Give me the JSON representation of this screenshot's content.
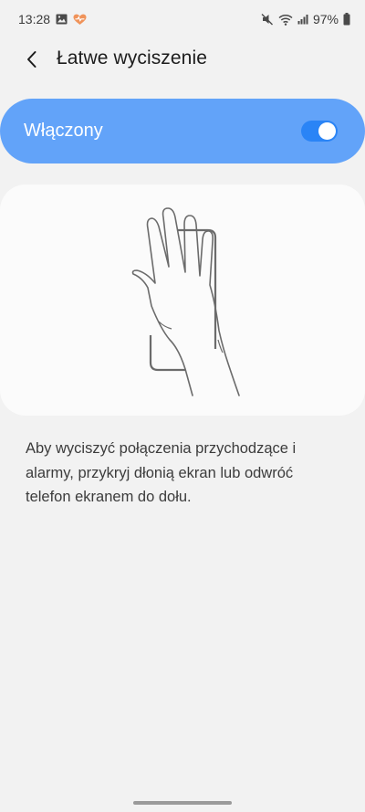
{
  "status_bar": {
    "time": "13:28",
    "battery": "97%",
    "icons": [
      "gallery-icon",
      "health-heart-icon",
      "mute-icon",
      "wifi-icon",
      "signal-icon",
      "battery-icon"
    ]
  },
  "header": {
    "title": "Łatwe wyciszenie",
    "back_icon": "chevron-left-icon"
  },
  "toggle": {
    "label": "Włączony",
    "state": "on",
    "card_color": "#62a3f9",
    "switch_color": "#2a84f6"
  },
  "illustration": {
    "icon": "hand-covering-phone-illustration"
  },
  "description": "Aby wyciszyć połączenia przychodzące i alarmy, przykryj dłonią ekran lub odwróć telefon ekranem do dołu."
}
